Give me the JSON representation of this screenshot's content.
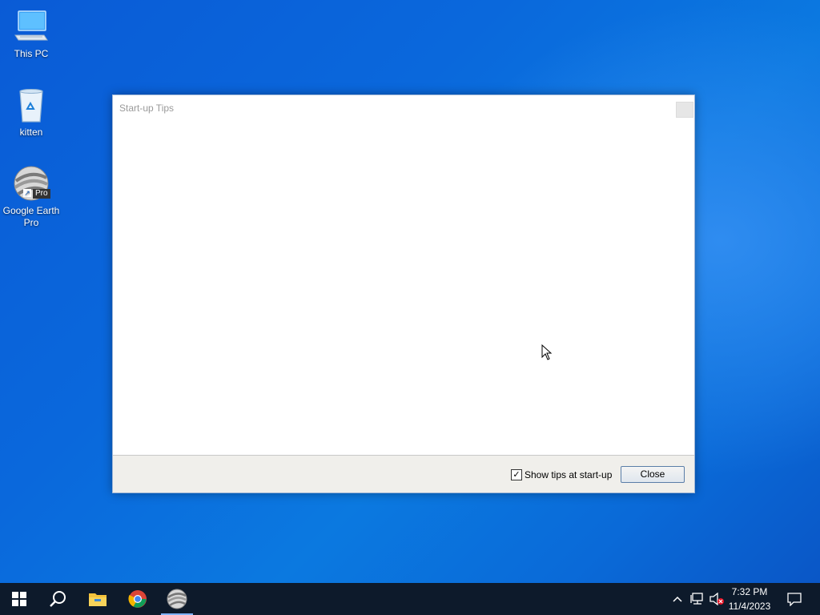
{
  "desktop": {
    "icons": [
      {
        "label": "This PC"
      },
      {
        "label": "kitten"
      },
      {
        "label": "Google Earth Pro",
        "badge": "Pro"
      }
    ]
  },
  "dialog": {
    "title": "Start-up Tips",
    "checkbox_label": "Show tips at start-up",
    "checkbox_checked": "✓",
    "close_button": "Close"
  },
  "taskbar": {
    "time": "7:32 PM",
    "date": "11/4/2023",
    "apps": [
      "start-icon",
      "search-icon",
      "file-explorer-icon",
      "chrome-icon",
      "google-earth-icon"
    ],
    "tray": [
      "chevron-up-icon",
      "network-icon",
      "volume-muted-icon",
      "notification-icon"
    ]
  },
  "colors": {
    "accent": "#0a5bd6",
    "taskbar": "#0d1a2b"
  }
}
